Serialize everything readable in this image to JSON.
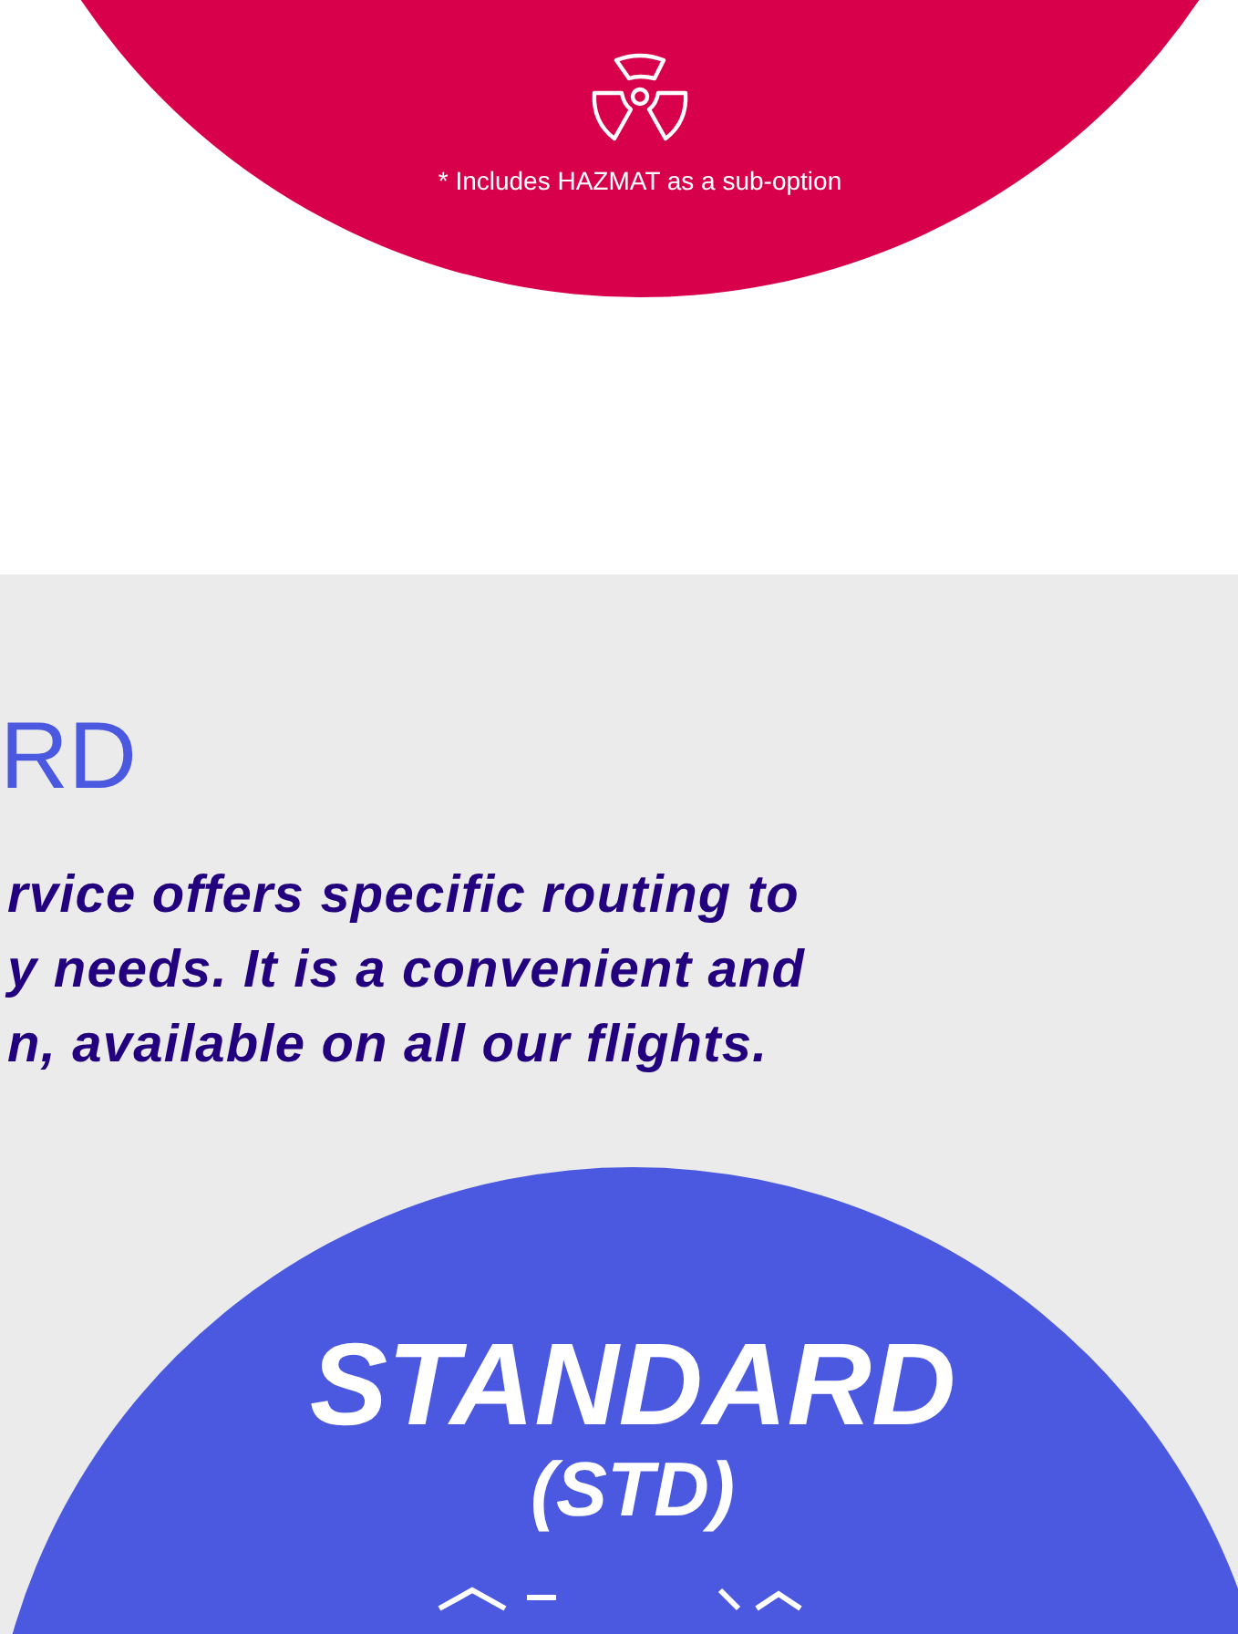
{
  "hazmat_panel": {
    "note": "* Includes HAZMAT as a sub-option"
  },
  "standard_section": {
    "heading": "RD",
    "description": "rvice offers specific routing to\ny needs. It is a convenient and\nn, available on all our flights.",
    "badge": {
      "title": "STANDARD",
      "code": "(STD)"
    }
  }
}
